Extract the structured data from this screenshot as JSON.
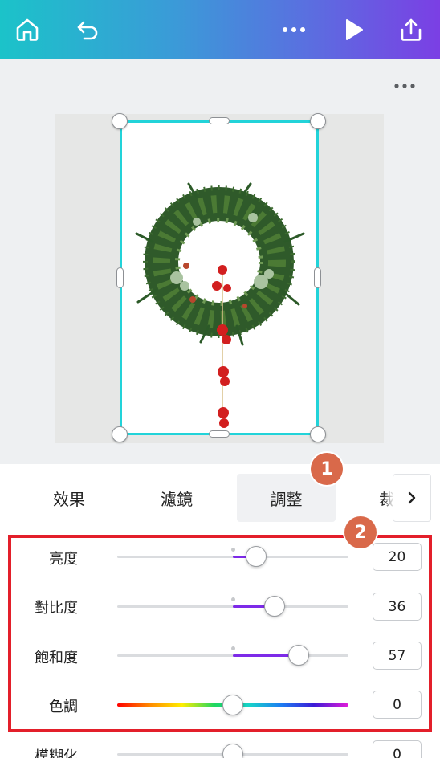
{
  "toolbar": {
    "home_icon": "home-icon",
    "undo_icon": "undo-icon",
    "more_icon": "more-horizontal-icon",
    "play_icon": "play-icon",
    "share_icon": "share-upload-icon",
    "gradient": [
      "#1bc3c9",
      "#7b3fe4"
    ]
  },
  "canvas": {
    "page_more_icon": "more-horizontal-icon",
    "selection_color": "#22d3d9",
    "image_subject": "christmas-wreath-image"
  },
  "tabs": {
    "items": [
      {
        "label": "效果",
        "active": false
      },
      {
        "label": "濾鏡",
        "active": false
      },
      {
        "label": "調整",
        "active": true
      },
      {
        "label": "裁切",
        "active": false
      }
    ],
    "next_icon": "chevron-right-icon"
  },
  "badges": {
    "one": "1",
    "two": "2",
    "color": "#d9694a"
  },
  "adjustments": {
    "accent": "#7d2ae8",
    "highlight_color": "#e31f2a",
    "rows": [
      {
        "label": "亮度",
        "value": "20",
        "level": 20
      },
      {
        "label": "對比度",
        "value": "36",
        "level": 36
      },
      {
        "label": "飽和度",
        "value": "57",
        "level": 57
      },
      {
        "label": "色調",
        "value": "0",
        "level": 0
      },
      {
        "label": "模糊化",
        "value": "0",
        "level": 0
      }
    ]
  }
}
